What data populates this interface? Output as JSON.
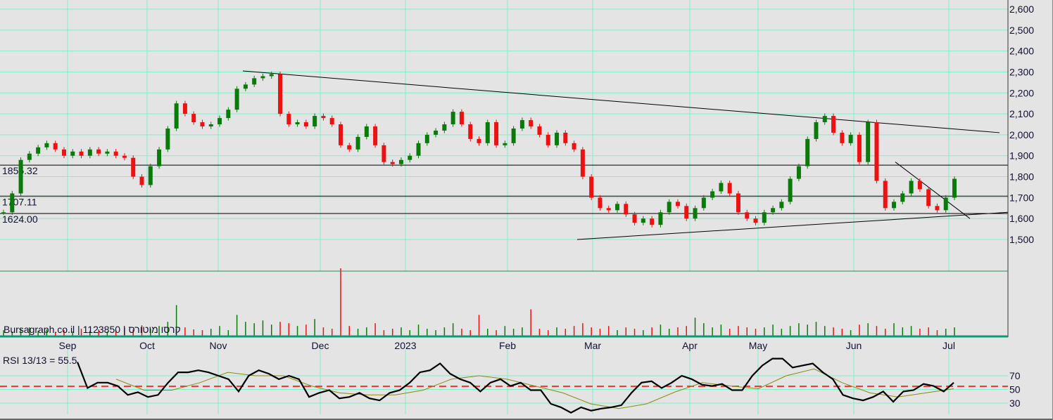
{
  "chart_data": {
    "type": "candlestick",
    "source_label": "Bursagraph.co.il | 1123850 | קרסו מוטורס",
    "x_tick_labels": [
      "Sep",
      "Oct",
      "Nov",
      "Dec",
      "2023",
      "Feb",
      "Mar",
      "Apr",
      "May",
      "Jun",
      "Jul"
    ],
    "y_tick_labels": [
      "2,600",
      "2,500",
      "2,400",
      "2,300",
      "2,200",
      "2,100",
      "2,000",
      "1,900",
      "1,800",
      "1,700",
      "1,600",
      "1,500"
    ],
    "y_ticks": [
      2600,
      2500,
      2400,
      2300,
      2200,
      2100,
      2000,
      1900,
      1800,
      1700,
      1600,
      1500
    ],
    "ylim": [
      1500,
      2600
    ],
    "start_open": 1630,
    "closes": [
      1630,
      1720,
      1880,
      1910,
      1940,
      1960,
      1930,
      1900,
      1920,
      1900,
      1930,
      1910,
      1920,
      1900,
      1890,
      1800,
      1760,
      1850,
      1930,
      2030,
      2150,
      2100,
      2060,
      2040,
      2050,
      2080,
      2120,
      2220,
      2240,
      2270,
      2280,
      2290,
      2100,
      2050,
      2060,
      2040,
      2090,
      2080,
      2050,
      1950,
      1930,
      1990,
      2040,
      1950,
      1870,
      1860,
      1880,
      1900,
      1960,
      2000,
      2020,
      2050,
      2110,
      2050,
      1980,
      1960,
      2060,
      1950,
      1960,
      2030,
      2070,
      2040,
      2000,
      1950,
      2010,
      1960,
      1930,
      1800,
      1700,
      1650,
      1640,
      1670,
      1620,
      1580,
      1600,
      1570,
      1630,
      1680,
      1660,
      1600,
      1650,
      1700,
      1730,
      1770,
      1720,
      1630,
      1600,
      1580,
      1630,
      1650,
      1680,
      1790,
      1850,
      1980,
      2060,
      2090,
      2010,
      1960,
      2000,
      1870,
      2060,
      1780,
      1650,
      1680,
      1720,
      1780,
      1740,
      1660,
      1640,
      1700,
      1790
    ],
    "volumes": [
      8,
      6,
      10,
      12,
      7,
      9,
      5,
      8,
      6,
      10,
      7,
      9,
      6,
      8,
      12,
      9,
      15,
      10,
      14,
      20,
      44,
      12,
      9,
      8,
      10,
      14,
      8,
      30,
      20,
      18,
      22,
      16,
      20,
      18,
      14,
      16,
      24,
      12,
      10,
      97,
      14,
      10,
      12,
      18,
      8,
      10,
      12,
      8,
      16,
      10,
      8,
      12,
      18,
      10,
      8,
      30,
      10,
      8,
      14,
      10,
      12,
      38,
      10,
      8,
      12,
      10,
      14,
      18,
      12,
      10,
      14,
      8,
      12,
      10,
      8,
      12,
      16,
      10,
      12,
      14,
      26,
      18,
      12,
      16,
      10,
      14,
      12,
      10,
      12,
      16,
      10,
      14,
      18,
      16,
      20,
      14,
      12,
      10,
      8,
      16,
      18,
      14,
      10,
      18,
      12,
      14,
      10,
      12,
      8,
      10,
      12
    ],
    "horizontal_levels": [
      {
        "value": 1855.32,
        "label": "1855.32"
      },
      {
        "value": 1707.11,
        "label": "1707.11"
      },
      {
        "value": 1624.0,
        "label": "1624.00"
      }
    ],
    "trendlines": [
      {
        "from_price": 2305,
        "to_price": 2010
      },
      {
        "from_price": 1500,
        "to_price": 1630
      },
      {
        "from_price": 1870,
        "to_price": 1600
      }
    ],
    "rsi": {
      "label": "RSI 13/13 = 55.5",
      "value": 55.5,
      "ticks": [
        70,
        50,
        30
      ],
      "tick_labels": [
        "70",
        "50",
        "30"
      ],
      "reference": 55.5,
      "values": [
        90,
        52,
        60,
        60,
        55,
        42,
        46,
        39,
        42,
        60,
        75,
        75,
        78,
        75,
        70,
        65,
        47,
        70,
        78,
        73,
        65,
        70,
        65,
        39,
        45,
        49,
        37,
        39,
        45,
        37,
        34,
        45,
        49,
        60,
        75,
        78,
        88,
        73,
        65,
        60,
        47,
        60,
        65,
        55,
        60,
        49,
        49,
        29,
        24,
        16,
        24,
        19,
        22,
        24,
        27,
        45,
        60,
        62,
        52,
        60,
        70,
        65,
        57,
        55,
        58,
        49,
        49,
        70,
        85,
        95,
        95,
        82,
        85,
        88,
        75,
        65,
        42,
        37,
        34,
        39,
        47,
        32,
        47,
        49,
        58,
        55,
        47,
        60
      ],
      "signal": [
        65,
        49,
        49,
        60,
        75,
        70,
        70,
        55,
        45,
        42,
        42,
        49,
        65,
        70,
        65,
        55,
        45,
        29,
        22,
        29,
        46,
        60,
        55,
        51,
        70,
        80,
        60,
        45,
        39,
        45,
        51
      ]
    },
    "colors": {
      "up": "#0a7a0a",
      "down": "#ee1111",
      "grid": "#80f0c8",
      "rsi_line": "#000000",
      "signal": "#8a8a10",
      "ref": "#ff0000"
    }
  }
}
